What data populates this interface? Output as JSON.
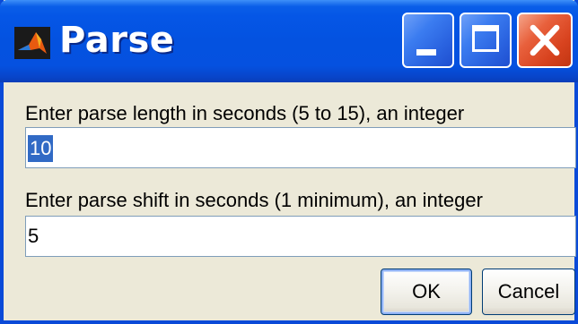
{
  "window": {
    "title": "Parse",
    "app_icon": "matlab-icon",
    "controls": {
      "minimize": "minimize-icon",
      "maximize": "maximize-icon",
      "close": "close-icon"
    }
  },
  "form": {
    "length_label": "Enter parse length in seconds (5 to 15), an integer",
    "length_value": "10",
    "shift_label": "Enter parse shift in seconds (1 minimum), an integer",
    "shift_value": "5"
  },
  "buttons": {
    "ok": "OK",
    "cancel": "Cancel"
  },
  "colors": {
    "titlebar": "#0452e0",
    "dialog_bg": "#ece9d8",
    "selection": "#316ac5",
    "close_button": "#d8431f"
  }
}
